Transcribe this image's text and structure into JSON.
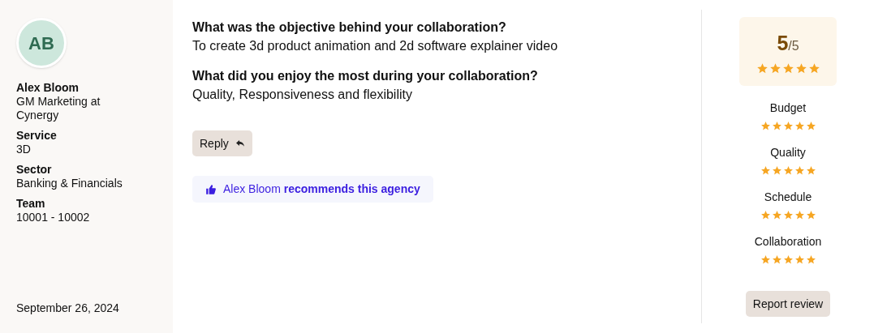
{
  "reviewer": {
    "initials": "AB",
    "name": "Alex Bloom",
    "role": "GM Marketing at Cynergy"
  },
  "details": [
    {
      "label": "Service",
      "value": "3D"
    },
    {
      "label": "Sector",
      "value": "Banking & Financials"
    },
    {
      "label": "Team",
      "value": "10001 - 10002"
    }
  ],
  "date": "September 26, 2024",
  "qa": [
    {
      "question": "What was the objective behind your collaboration?",
      "answer": "To create 3d product animation and 2d software explainer video"
    },
    {
      "question": "What did you enjoy the most during your collaboration?",
      "answer": "Quality, Responsiveness and flexibility"
    }
  ],
  "reply_button": "Reply",
  "recommendation": "Alex Bloom **recommends this agency**",
  "overall": {
    "score": "5",
    "out_of": "/5",
    "stars": 5
  },
  "ratings": [
    {
      "label": "Budget",
      "stars": 5
    },
    {
      "label": "Quality",
      "stars": 5
    },
    {
      "label": "Schedule",
      "stars": 5
    },
    {
      "label": "Collaboration",
      "stars": 5
    }
  ],
  "report_button": "Report review"
}
